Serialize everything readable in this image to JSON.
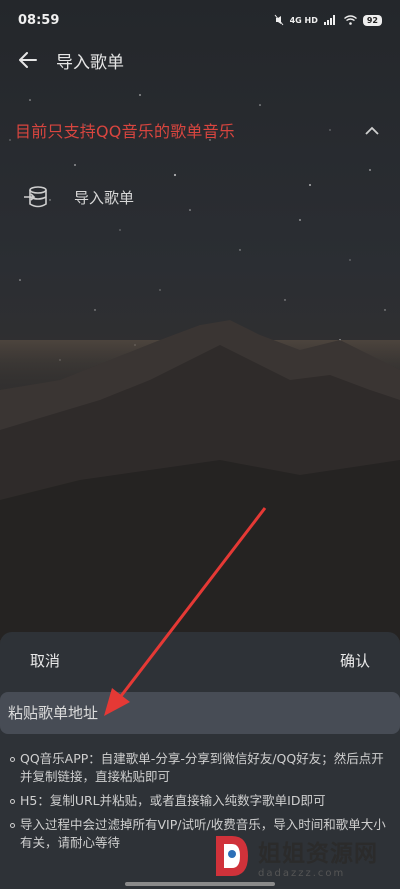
{
  "status_bar": {
    "time": "08:59",
    "network": "4G HD",
    "battery": "92"
  },
  "app_bar": {
    "title": "导入歌单"
  },
  "notice": {
    "text": "目前只支持QQ音乐的歌单音乐",
    "color": "#d8453f"
  },
  "import_option": {
    "label": "导入歌单"
  },
  "sheet": {
    "cancel_label": "取消",
    "confirm_label": "确认",
    "input_placeholder": "粘贴歌单地址",
    "tips": [
      "QQ音乐APP：自建歌单-分享-分享到微信好友/QQ好友；然后点开并复制链接，直接粘贴即可",
      "H5：复制URL并粘贴，或者直接输入纯数字歌单ID即可",
      "导入过程中会过滤掉所有VIP/试听/收费音乐，导入时间和歌单大小有关，请耐心等待"
    ]
  },
  "watermark": {
    "title": "姐姐资源网",
    "subtitle": "dadazzz.com"
  }
}
